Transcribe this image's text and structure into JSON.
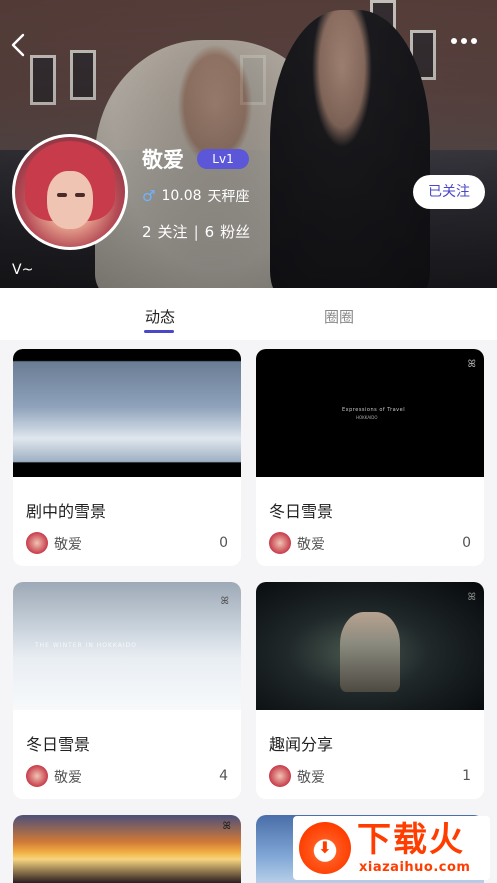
{
  "header": {
    "user_name": "敬爱",
    "level": "Lv1",
    "gender_symbol": "♂",
    "birthday": "10.08",
    "zodiac": "天秤座",
    "following_count": "2",
    "following_label": "关注",
    "followers_count": "6",
    "followers_label": "粉丝",
    "follow_button_label": "已关注",
    "signature": "V~"
  },
  "tabs": [
    {
      "label": "动态",
      "active": true
    },
    {
      "label": "圈圈",
      "active": false
    }
  ],
  "cards": [
    {
      "title": "剧中的雪景",
      "author": "敬爱",
      "count": "0"
    },
    {
      "title": "冬日雪景",
      "author": "敬爱",
      "count": "0",
      "thumb_text": "Expressions of Travel",
      "thumb_sub": "HOKKAIDO"
    },
    {
      "title": "冬日雪景",
      "author": "敬爱",
      "count": "4",
      "thumb_text": "THE WINTER IN HOKKAIDO"
    },
    {
      "title": "趣闻分享",
      "author": "敬爱",
      "count": "1"
    }
  ],
  "watermark": {
    "title": "下载火",
    "url": "xiazaihuo.com"
  },
  "colors": {
    "accent": "#4a47c8",
    "level_badge": "#5b57d8",
    "watermark": "#ff3d00"
  }
}
